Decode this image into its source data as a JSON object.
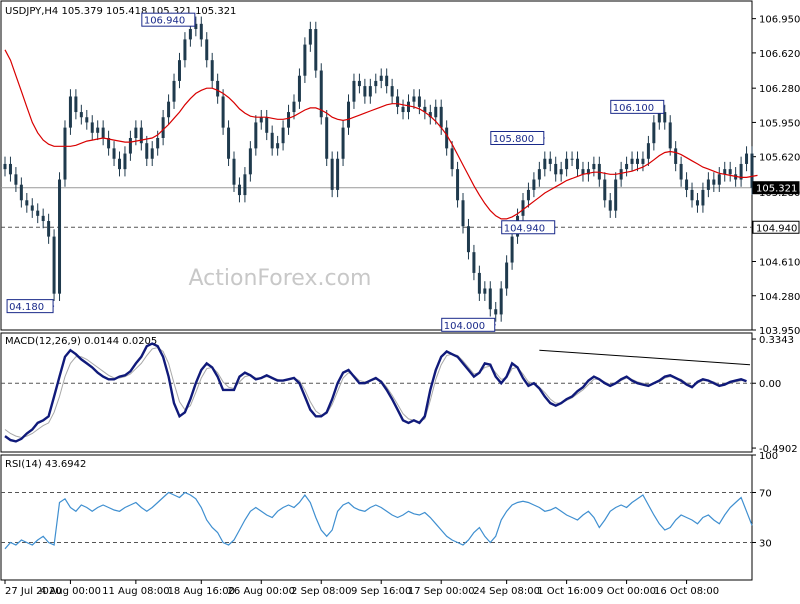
{
  "colors": {
    "background": "#ffffff",
    "frame": "#000000",
    "candle": "#1f3a4d",
    "ma": "#d80000",
    "macd": "#101a7a",
    "signal": "#a8a8a8",
    "rsi": "#3f8fd0",
    "level": "#555555",
    "price_line": "#999999",
    "label_text": "#1a2a8a",
    "watermark": "#c8c8c8"
  },
  "watermark": "ActionForex.com",
  "chart_data": [
    {
      "panel": "price",
      "type": "candlestick",
      "title": "USDJPY,H4  105.379 105.418 105.321 105.321",
      "ylim": [
        103.95,
        107.12
      ],
      "y_ticks": [
        "106.950",
        "106.620",
        "106.280",
        "105.950",
        "105.620",
        "105.280",
        "104.610",
        "104.280",
        "103.950"
      ],
      "y_tick_values": [
        106.95,
        106.62,
        106.28,
        105.95,
        105.62,
        105.28,
        104.61,
        104.28,
        103.95
      ],
      "close_series": [
        105.55,
        105.45,
        105.35,
        105.2,
        105.15,
        105.1,
        105.05,
        105.0,
        104.85,
        104.3,
        105.4,
        105.9,
        106.2,
        106.05,
        106.0,
        105.95,
        105.85,
        105.9,
        105.8,
        105.7,
        105.6,
        105.5,
        105.65,
        105.8,
        105.9,
        105.75,
        105.6,
        105.7,
        105.8,
        106.0,
        106.15,
        106.35,
        106.55,
        106.75,
        106.85,
        106.9,
        106.75,
        106.55,
        106.35,
        106.2,
        105.9,
        105.6,
        105.35,
        105.25,
        105.45,
        105.7,
        105.95,
        106.0,
        105.85,
        105.7,
        105.75,
        105.9,
        106.05,
        106.15,
        106.4,
        106.7,
        106.85,
        106.45,
        106.0,
        105.6,
        105.3,
        105.6,
        105.9,
        106.15,
        106.35,
        106.3,
        106.2,
        106.3,
        106.35,
        106.4,
        106.3,
        106.2,
        106.1,
        106.05,
        106.15,
        106.2,
        106.1,
        106.05,
        106.0,
        106.1,
        105.9,
        105.7,
        105.5,
        105.2,
        104.95,
        104.7,
        104.5,
        104.3,
        104.35,
        104.15,
        104.1,
        104.35,
        104.6,
        104.85,
        105.05,
        105.2,
        105.3,
        105.4,
        105.5,
        105.6,
        105.55,
        105.45,
        105.5,
        105.6,
        105.6,
        105.5,
        105.45,
        105.5,
        105.55,
        105.4,
        105.2,
        105.1,
        105.4,
        105.5,
        105.55,
        105.6,
        105.55,
        105.6,
        105.75,
        105.95,
        106.05,
        105.95,
        105.7,
        105.55,
        105.4,
        105.3,
        105.2,
        105.15,
        105.3,
        105.4,
        105.35,
        105.45,
        105.5,
        105.45,
        105.4,
        105.55,
        105.65,
        105.321
      ],
      "ma_series": [
        106.65,
        106.55,
        106.4,
        106.25,
        106.1,
        105.95,
        105.85,
        105.78,
        105.74,
        105.72,
        105.72,
        105.72,
        105.72,
        105.73,
        105.75,
        105.77,
        105.78,
        105.79,
        105.8,
        105.79,
        105.78,
        105.77,
        105.76,
        105.76,
        105.77,
        105.78,
        105.79,
        105.8,
        105.83,
        105.88,
        105.93,
        105.99,
        106.05,
        106.12,
        106.18,
        106.23,
        106.26,
        106.28,
        106.28,
        106.26,
        106.23,
        106.19,
        106.14,
        106.08,
        106.04,
        106.01,
        106.0,
        106.0,
        106.0,
        105.99,
        105.98,
        105.98,
        105.99,
        106.01,
        106.04,
        106.07,
        106.09,
        106.09,
        106.07,
        106.04,
        106.0,
        105.98,
        105.97,
        105.98,
        106.0,
        106.02,
        106.04,
        106.06,
        106.08,
        106.1,
        106.12,
        106.13,
        106.13,
        106.12,
        106.11,
        106.1,
        106.08,
        106.05,
        106.01,
        105.96,
        105.9,
        105.83,
        105.74,
        105.64,
        105.54,
        105.44,
        105.34,
        105.25,
        105.17,
        105.1,
        105.05,
        105.02,
        105.02,
        105.04,
        105.07,
        105.11,
        105.15,
        105.19,
        105.23,
        105.27,
        105.3,
        105.33,
        105.36,
        105.39,
        105.41,
        105.43,
        105.45,
        105.46,
        105.47,
        105.47,
        105.46,
        105.45,
        105.45,
        105.46,
        105.47,
        105.48,
        105.5,
        105.52,
        105.55,
        105.59,
        105.63,
        105.66,
        105.67,
        105.66,
        105.64,
        105.61,
        105.58,
        105.55,
        105.52,
        105.5,
        105.48,
        105.46,
        105.45,
        105.44,
        105.43,
        105.42,
        105.42,
        105.43,
        105.44
      ],
      "level_price": 104.94,
      "level_label": "104.940",
      "current_price": 105.321,
      "current_label": "105.321",
      "annotations": [
        {
          "label": "04.180",
          "x_index": 9,
          "price": 104.18
        },
        {
          "label": "106.940",
          "x_index": 35,
          "price": 106.94
        },
        {
          "label": "105.800",
          "x_index": 99,
          "price": 105.8
        },
        {
          "label": "104.940",
          "x_index": 101,
          "price": 104.94
        },
        {
          "label": "104.000",
          "x_index": 90,
          "price": 104.0
        },
        {
          "label": "106.100",
          "x_index": 121,
          "price": 106.1
        }
      ]
    },
    {
      "panel": "macd",
      "type": "line",
      "title": "MACD(12,26,9) 0.0144 0.0205",
      "ylim": [
        -0.52,
        0.38
      ],
      "y_ticks": [
        "0.3343",
        "0.00",
        "-0.4902"
      ],
      "y_tick_values": [
        0.3343,
        0.0,
        -0.4902
      ],
      "series": [
        {
          "values": [
            -0.4,
            -0.43,
            -0.44,
            -0.42,
            -0.38,
            -0.35,
            -0.3,
            -0.28,
            -0.25,
            -0.1,
            0.05,
            0.2,
            0.25,
            0.22,
            0.18,
            0.15,
            0.12,
            0.08,
            0.05,
            0.03,
            0.03,
            0.05,
            0.06,
            0.09,
            0.15,
            0.2,
            0.28,
            0.3,
            0.28,
            0.2,
            0.05,
            -0.15,
            -0.25,
            -0.22,
            -0.12,
            0.0,
            0.1,
            0.15,
            0.12,
            0.05,
            -0.05,
            -0.05,
            -0.05,
            0.05,
            0.08,
            0.06,
            0.03,
            0.04,
            0.06,
            0.04,
            0.02,
            0.02,
            0.03,
            0.04,
            0.0,
            -0.1,
            -0.2,
            -0.25,
            -0.25,
            -0.22,
            -0.12,
            0.0,
            0.08,
            0.1,
            0.05,
            0.0,
            0.0,
            0.02,
            0.04,
            0.01,
            -0.05,
            -0.12,
            -0.2,
            -0.28,
            -0.3,
            -0.28,
            -0.3,
            -0.25,
            -0.05,
            0.1,
            0.2,
            0.24,
            0.22,
            0.2,
            0.15,
            0.1,
            0.05,
            0.08,
            0.15,
            0.14,
            0.05,
            0.0,
            0.05,
            0.15,
            0.12,
            0.04,
            -0.02,
            0.0,
            -0.04,
            -0.1,
            -0.15,
            -0.17,
            -0.15,
            -0.12,
            -0.1,
            -0.06,
            -0.03,
            0.02,
            0.05,
            0.03,
            0.0,
            -0.02,
            0.0,
            0.03,
            0.05,
            0.02,
            0.0,
            -0.01,
            -0.02,
            0.0,
            0.02,
            0.05,
            0.06,
            0.04,
            0.02,
            -0.01,
            -0.03,
            0.01,
            0.03,
            0.02,
            0.0,
            -0.02,
            -0.01,
            0.01,
            0.02,
            0.03,
            0.0144
          ]
        },
        {
          "values": [
            -0.35,
            -0.38,
            -0.4,
            -0.41,
            -0.4,
            -0.38,
            -0.35,
            -0.32,
            -0.3,
            -0.22,
            -0.1,
            0.05,
            0.15,
            0.2,
            0.2,
            0.18,
            0.15,
            0.12,
            0.09,
            0.06,
            0.04,
            0.04,
            0.05,
            0.07,
            0.11,
            0.15,
            0.21,
            0.26,
            0.27,
            0.24,
            0.15,
            0.0,
            -0.14,
            -0.2,
            -0.17,
            -0.07,
            0.04,
            0.11,
            0.12,
            0.08,
            0.01,
            -0.03,
            -0.04,
            0.01,
            0.05,
            0.06,
            0.04,
            0.04,
            0.05,
            0.04,
            0.03,
            0.02,
            0.03,
            0.04,
            0.02,
            -0.05,
            -0.14,
            -0.21,
            -0.24,
            -0.23,
            -0.16,
            -0.06,
            0.04,
            0.08,
            0.06,
            0.02,
            0.01,
            0.02,
            0.03,
            0.02,
            -0.03,
            -0.09,
            -0.16,
            -0.23,
            -0.27,
            -0.28,
            -0.29,
            -0.27,
            -0.13,
            0.03,
            0.14,
            0.21,
            0.22,
            0.21,
            0.17,
            0.12,
            0.07,
            0.08,
            0.12,
            0.13,
            0.08,
            0.03,
            0.04,
            0.11,
            0.12,
            0.07,
            0.01,
            0.0,
            -0.03,
            -0.07,
            -0.12,
            -0.15,
            -0.15,
            -0.13,
            -0.11,
            -0.08,
            -0.05,
            -0.01,
            0.03,
            0.03,
            0.01,
            -0.01,
            0.0,
            0.02,
            0.04,
            0.03,
            0.01,
            0.0,
            -0.01,
            0.0,
            0.01,
            0.04,
            0.05,
            0.04,
            0.03,
            0.0,
            -0.02,
            0.0,
            0.02,
            0.02,
            0.01,
            -0.01,
            -0.01,
            0.0,
            0.01,
            0.02,
            0.0205
          ]
        }
      ]
    },
    {
      "panel": "rsi",
      "type": "line",
      "title": "RSI(14) 43.6942",
      "ylim": [
        0,
        100
      ],
      "y_ticks": [
        "100",
        "70",
        "30",
        "0"
      ],
      "y_tick_values": [
        100,
        70,
        30,
        0
      ],
      "levels": [
        70,
        30
      ],
      "series": [
        {
          "values": [
            25,
            30,
            28,
            32,
            30,
            28,
            32,
            35,
            30,
            28,
            62,
            65,
            58,
            55,
            60,
            58,
            55,
            58,
            60,
            58,
            56,
            55,
            58,
            60,
            62,
            58,
            55,
            58,
            62,
            66,
            70,
            68,
            66,
            70,
            68,
            65,
            58,
            48,
            42,
            38,
            30,
            28,
            32,
            40,
            48,
            55,
            58,
            55,
            52,
            50,
            55,
            58,
            60,
            58,
            62,
            68,
            62,
            50,
            40,
            35,
            40,
            55,
            60,
            62,
            58,
            56,
            55,
            58,
            60,
            58,
            55,
            52,
            50,
            52,
            55,
            53,
            52,
            54,
            50,
            45,
            40,
            35,
            32,
            30,
            28,
            32,
            38,
            42,
            35,
            30,
            35,
            48,
            55,
            60,
            62,
            63,
            62,
            60,
            58,
            55,
            56,
            58,
            55,
            52,
            50,
            48,
            52,
            55,
            50,
            42,
            48,
            55,
            58,
            60,
            58,
            62,
            65,
            68,
            60,
            52,
            45,
            40,
            42,
            48,
            52,
            50,
            48,
            45,
            50,
            52,
            48,
            45,
            52,
            58,
            62,
            66,
            55,
            43.6942
          ]
        }
      ]
    }
  ],
  "time_axis": {
    "labels": [
      "27 Jul 2020",
      "4 Aug 00:00",
      "11 Aug 08:00",
      "18 Aug 16:00",
      "26 Aug 00:00",
      "2 Sep 08:00",
      "9 Sep 16:00",
      "17 Sep 00:00",
      "24 Sep 08:00",
      "1 Oct 16:00",
      "9 Oct 00:00",
      "16 Oct 08:00"
    ],
    "label_indices": [
      0,
      12,
      24,
      36,
      47,
      58,
      69,
      80,
      92,
      103,
      114,
      125
    ]
  }
}
